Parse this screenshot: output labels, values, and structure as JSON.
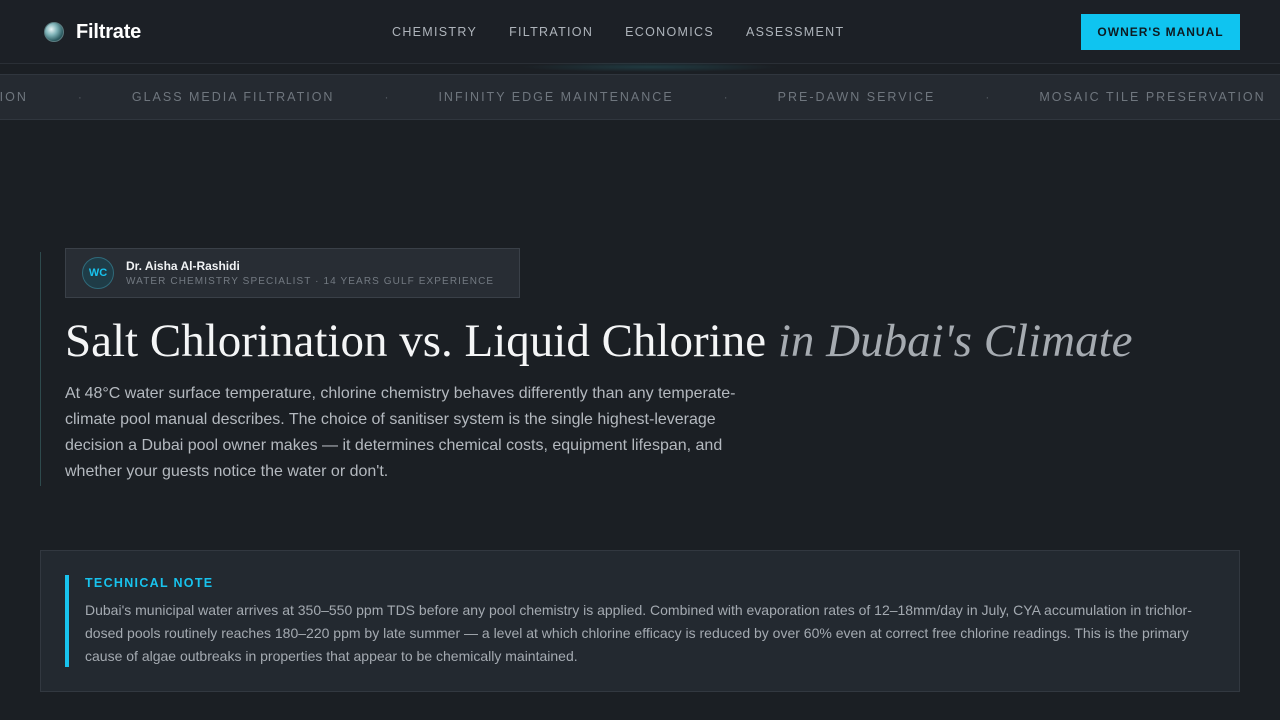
{
  "header": {
    "brand": "Filtrate",
    "brand_icon": "water-drop-logo-icon",
    "nav": [
      "CHEMISTRY",
      "FILTRATION",
      "ECONOMICS",
      "ASSESSMENT"
    ],
    "cta_label": "OWNER'S MANUAL"
  },
  "ticker": {
    "items": [
      "TION",
      "GLASS MEDIA FILTRATION",
      "INFINITY EDGE MAINTENANCE",
      "PRE-DAWN SERVICE",
      "MOSAIC TILE PRESERVATION"
    ],
    "separator": "·"
  },
  "author": {
    "initials": "WC",
    "name": "Dr. Aisha Al-Rashidi",
    "role": "WATER CHEMISTRY SPECIALIST · 14 YEARS GULF EXPERIENCE"
  },
  "hero": {
    "title_main": "Salt Chlorination vs. Liquid Chlorine",
    "title_accent": "in Dubai's Climate",
    "description": "At 48°C water surface temperature, chlorine chemistry behaves differently than any temperate-climate pool manual describes. The choice of sanitiser system is the single highest-leverage decision a Dubai pool owner makes — it determines chemical costs, equipment lifespan, and whether your guests notice the water or don't."
  },
  "note": {
    "label": "TECHNICAL NOTE",
    "text": "Dubai's municipal water arrives at 350–550 ppm TDS before any pool chemistry is applied. Combined with evaporation rates of 12–18mm/day in July, CYA accumulation in trichlor-dosed pools routinely reaches 180–220 ppm by late summer — a level at which chlorine efficacy is reduced by over 60% even at correct free chlorine readings. This is the primary cause of algae outbreaks in properties that appear to be chemically maintained."
  },
  "colors": {
    "accent": "#0fc4f0",
    "background": "#1b1f24"
  }
}
